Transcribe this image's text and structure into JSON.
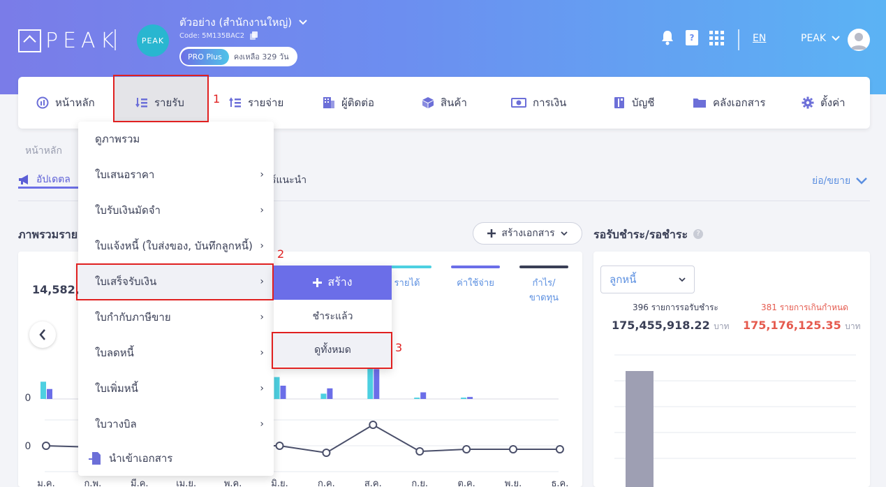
{
  "header": {
    "logo_text": "PEAK",
    "org_avatar_text": "PEAK",
    "org_name": "ตัวอย่าง (สำนักงานใหญ่)",
    "org_code": "Code: 5M135BAC2",
    "plan_badge": "PRO Plus",
    "plan_days": "คงเหลือ 329 วัน",
    "lang": "EN",
    "user": "PEAK"
  },
  "nav": {
    "items": [
      {
        "label": "หน้าหลัก",
        "icon": "dashboard-icon"
      },
      {
        "label": "รายรับ",
        "icon": "income-icon"
      },
      {
        "label": "รายจ่าย",
        "icon": "expense-icon"
      },
      {
        "label": "ผู้ติดต่อ",
        "icon": "contacts-icon"
      },
      {
        "label": "สินค้า",
        "icon": "product-icon"
      },
      {
        "label": "การเงิน",
        "icon": "money-icon"
      },
      {
        "label": "บัญชี",
        "icon": "accounting-icon"
      },
      {
        "label": "คลังเอกสาร",
        "icon": "folder-icon"
      },
      {
        "label": "ตั้งค่า",
        "icon": "gear-icon"
      }
    ]
  },
  "annotations": {
    "n1": "1",
    "n2": "2",
    "n3": "3"
  },
  "page": {
    "breadcrumb": "หน้าหลัก",
    "tab_active": "อัปเดตล",
    "tab_other": "ร์แนะนำ",
    "collapse": "ย่อ/ขยาย",
    "overview_title": "ภาพรวมราย",
    "create_doc": "สร้างเอกสาร",
    "receivable_title": "รอรับชำระ/รอชำระ"
  },
  "dropdown": {
    "items": [
      {
        "label": "ดูภาพรวม",
        "has_sub": false
      },
      {
        "label": "ใบเสนอราคา",
        "has_sub": true
      },
      {
        "label": "ใบรับเงินมัดจำ",
        "has_sub": true
      },
      {
        "label": "ใบแจ้งหนี้ (ใบส่งของ, บันทึกลูกหนี้)",
        "has_sub": true
      },
      {
        "label": "ใบเสร็จรับเงิน",
        "has_sub": true
      },
      {
        "label": "ใบกำกับภาษีขาย",
        "has_sub": true
      },
      {
        "label": "ใบลดหนี้",
        "has_sub": true
      },
      {
        "label": "ใบเพิ่มหนี้",
        "has_sub": true
      },
      {
        "label": "ใบวางบิล",
        "has_sub": true
      }
    ],
    "import_label": "นำเข้าเอกสาร"
  },
  "submenu": {
    "create": "สร้าง",
    "paid": "ชำระแล้ว",
    "view_all": "ดูทั้งหมด"
  },
  "chart_data": {
    "type": "bar",
    "categories": [
      "ม.ค.",
      "ก.พ.",
      "มี.ค.",
      "เม.ย.",
      "พ.ค.",
      "มิ.ย.",
      "ก.ค.",
      "ส.ค.",
      "ก.ย.",
      "ต.ค.",
      "พ.ย.",
      "ธ.ค."
    ],
    "series": [
      {
        "name": "รายได้",
        "color": "#4dd0e1",
        "values": [
          26,
          0,
          0,
          0,
          0,
          33,
          8,
          62,
          2,
          2,
          0,
          0
        ]
      },
      {
        "name": "ค่าใช้จ่าย",
        "color": "#6b6ee8",
        "values": [
          15,
          0,
          0,
          0,
          0,
          20,
          16,
          45,
          10,
          3,
          0,
          0
        ]
      },
      {
        "name": "กำไร/ขาดทุน",
        "color": "#3a3f56",
        "values": [
          0,
          -2,
          0,
          0,
          0,
          0,
          -10,
          30,
          -8,
          -5,
          -5,
          -5
        ]
      }
    ],
    "y_top_label": "14,582,",
    "zero_label": "0"
  },
  "receivable": {
    "filter": "ลูกหนี้",
    "left_label": "396 รายการรอรับชำระ",
    "left_value": "175,455,918.22",
    "right_label": "381 รายการเกินกำหนด",
    "right_value": "175,176,125.35",
    "unit": "บาท",
    "bar_color": "#9e9fb3"
  }
}
